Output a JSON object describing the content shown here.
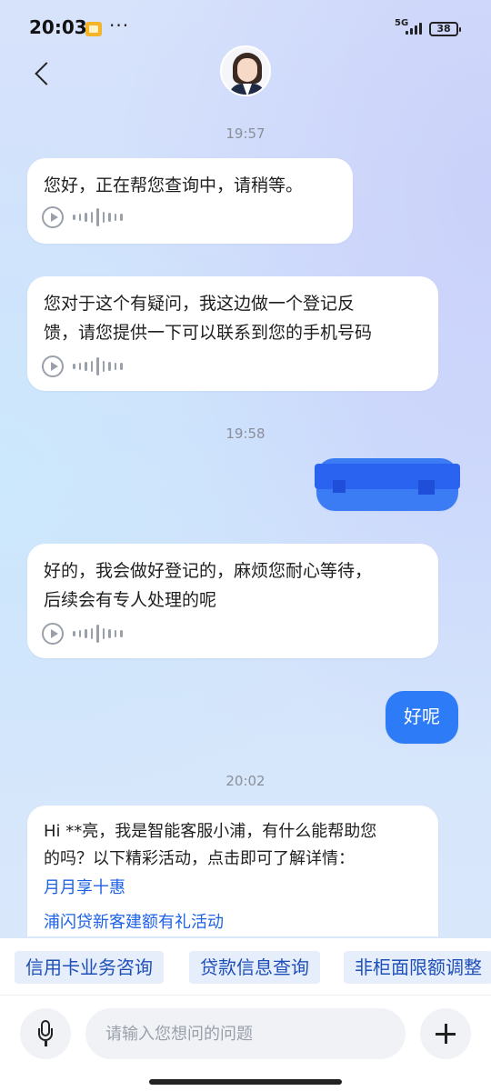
{
  "status_bar": {
    "time": "20:03",
    "dots": "···",
    "network": "5G",
    "battery": "38"
  },
  "header": {
    "back_icon": "chevron-left-icon",
    "avatar_icon": "agent-avatar"
  },
  "chat": {
    "messages": [
      {
        "type": "time",
        "text": "19:57"
      },
      {
        "type": "bot",
        "text": "您好，正在帮您查询中，请稍等。",
        "voice": true
      },
      {
        "type": "bot",
        "lines": [
          "您对于这个有疑问，我这边做一个登记反",
          "馈，请您提供一下可以联系到您的手机号码"
        ],
        "voice": true
      },
      {
        "type": "time",
        "text": "19:58"
      },
      {
        "type": "user",
        "text": "[redacted]",
        "redacted": true
      },
      {
        "type": "bot",
        "lines": [
          "好的，我会做好登记的，麻烦您耐心等待，",
          "后续会有专人处理的呢"
        ],
        "voice": true
      },
      {
        "type": "user",
        "text": "好呢"
      },
      {
        "type": "time",
        "text": "20:02"
      },
      {
        "type": "bot",
        "lines": [
          "Hi **亮，我是智能客服小浦，有什么能帮助您",
          "的吗？以下精彩活动，点击即可了解详情："
        ],
        "links": [
          "月月享十惠",
          "浦闪贷新客建额有礼活动"
        ]
      }
    ]
  },
  "quick_replies": [
    "信用卡业务咨询",
    "贷款信息查询",
    "非柜面限额调整"
  ],
  "input": {
    "placeholder": "请输入您想问的问题"
  },
  "colors": {
    "user_bubble": "#2d7bf6",
    "link": "#1e62e6",
    "chip_bg": "#e6eefc"
  }
}
